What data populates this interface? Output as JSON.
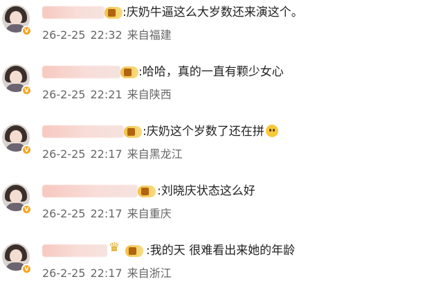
{
  "comments": [
    {
      "text": ":庆奶牛逼这么大岁数还来演这个。",
      "date": "26-2-25",
      "time": "22:32",
      "location": "来自福建"
    },
    {
      "text": ":哈哈，真的一直有颗少女心",
      "date": "26-2-25",
      "time": "22:21",
      "location": "来自陕西"
    },
    {
      "text": ":庆奶这个岁数了还在拼",
      "date": "26-2-25",
      "time": "22:17",
      "location": "来自黑龙江"
    },
    {
      "text": ":刘晓庆状态这么好",
      "date": "26-2-25",
      "time": "22:17",
      "location": "来自重庆"
    },
    {
      "text": ":我的天 很难看出来她的年龄",
      "date": "26-2-25",
      "time": "22:17",
      "location": "来自浙江"
    }
  ],
  "colors": {
    "accent": "#f5a623",
    "text": "#222222",
    "meta": "#666666"
  },
  "icons": {
    "verified": "v-badge-icon",
    "vip": "vip-tag-icon",
    "crown": "crown-icon",
    "emoji": "emoji-icon"
  }
}
